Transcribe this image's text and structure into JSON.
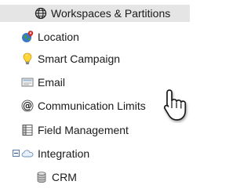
{
  "tree": {
    "items": [
      {
        "label": "Workspaces & Partitions",
        "icon": "globe-icon"
      },
      {
        "label": "Location",
        "icon": "location-globe-icon"
      },
      {
        "label": "Smart Campaign",
        "icon": "lightbulb-icon"
      },
      {
        "label": "Email",
        "icon": "email-icon"
      },
      {
        "label": "Communication Limits",
        "icon": "at-sign-icon"
      },
      {
        "label": "Field Management",
        "icon": "field-table-icon"
      },
      {
        "label": "Integration",
        "icon": "cloud-icon",
        "expanded": true
      },
      {
        "label": "CRM",
        "icon": "database-icon"
      }
    ],
    "selected_index": 0
  },
  "cursor": {
    "icon": "hand-pointer-cursor-icon"
  },
  "colors": {
    "selected_row_bg": "#e5e5e5",
    "text": "#1a1a1a",
    "expander_border": "#5a7aa8"
  }
}
